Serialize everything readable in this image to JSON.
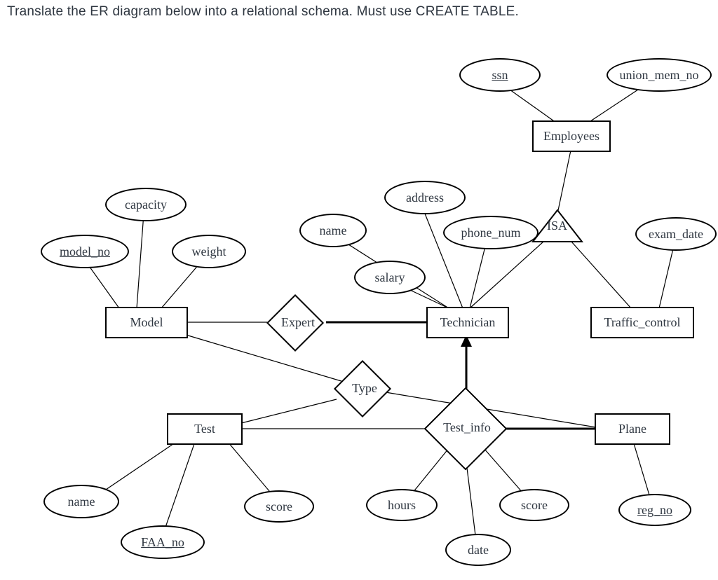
{
  "instruction": "Translate the ER diagram below into a relational schema. Must use CREATE TABLE.",
  "entities": {
    "employees": "Employees",
    "technician": "Technician",
    "traffic_control": "Traffic_control",
    "model": "Model",
    "test": "Test",
    "plane": "Plane"
  },
  "relationships": {
    "isa": "ISA",
    "expert": "Expert",
    "type": "Type",
    "test_info": "Test_info"
  },
  "attributes": {
    "ssn": "ssn",
    "union_mem_no": "union_mem_no",
    "capacity": "capacity",
    "model_no": "model_no",
    "weight": "weight",
    "name_tech": "name",
    "address": "address",
    "phone_num": "phone_num",
    "salary": "salary",
    "exam_date": "exam_date",
    "name_test": "name",
    "faa_no": "FAA_no",
    "score_test": "score",
    "hours": "hours",
    "score_ti": "score",
    "date": "date",
    "reg_no": "reg_no"
  }
}
